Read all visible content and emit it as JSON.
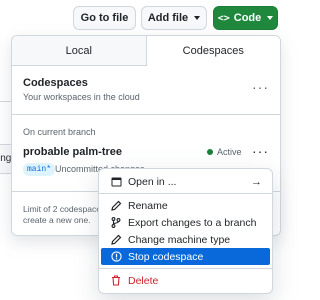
{
  "toolbar": {
    "goto_file_label": "Go to file",
    "add_file_label": "Add file",
    "code_label": "Code"
  },
  "background": {
    "left_fragment_text": "ing a"
  },
  "panel": {
    "tabs": [
      {
        "label": "Local",
        "active": false
      },
      {
        "label": "Codespaces",
        "active": true
      }
    ],
    "codespaces_title": "Codespaces",
    "codespaces_subtitle": "Your workspaces in the cloud",
    "branch_section_label": "On current branch",
    "codespace": {
      "name": "probable palm-tree",
      "status": "Active",
      "branch": "main*",
      "changes": "Uncommitted changes"
    },
    "footer_line1": "Limit of 2 codespaces",
    "footer_line2": "create a new one."
  },
  "menu": {
    "items": [
      {
        "label": "Open in ...",
        "icon": "browser-icon",
        "submenu": true
      },
      {
        "label": "Rename",
        "icon": "pencil-icon"
      },
      {
        "label": "Export changes to a branch",
        "icon": "git-branch-icon"
      },
      {
        "label": "Change machine type",
        "icon": "pencil-icon"
      },
      {
        "label": "Stop codespace",
        "icon": "stop-icon",
        "selected": true
      },
      {
        "label": "Delete",
        "icon": "trash-icon",
        "danger": true
      }
    ]
  },
  "colors": {
    "accent_green": "#1f883d",
    "selection_blue": "#0969da",
    "danger_red": "#cf222e",
    "active_dot": "#1a7f37"
  }
}
